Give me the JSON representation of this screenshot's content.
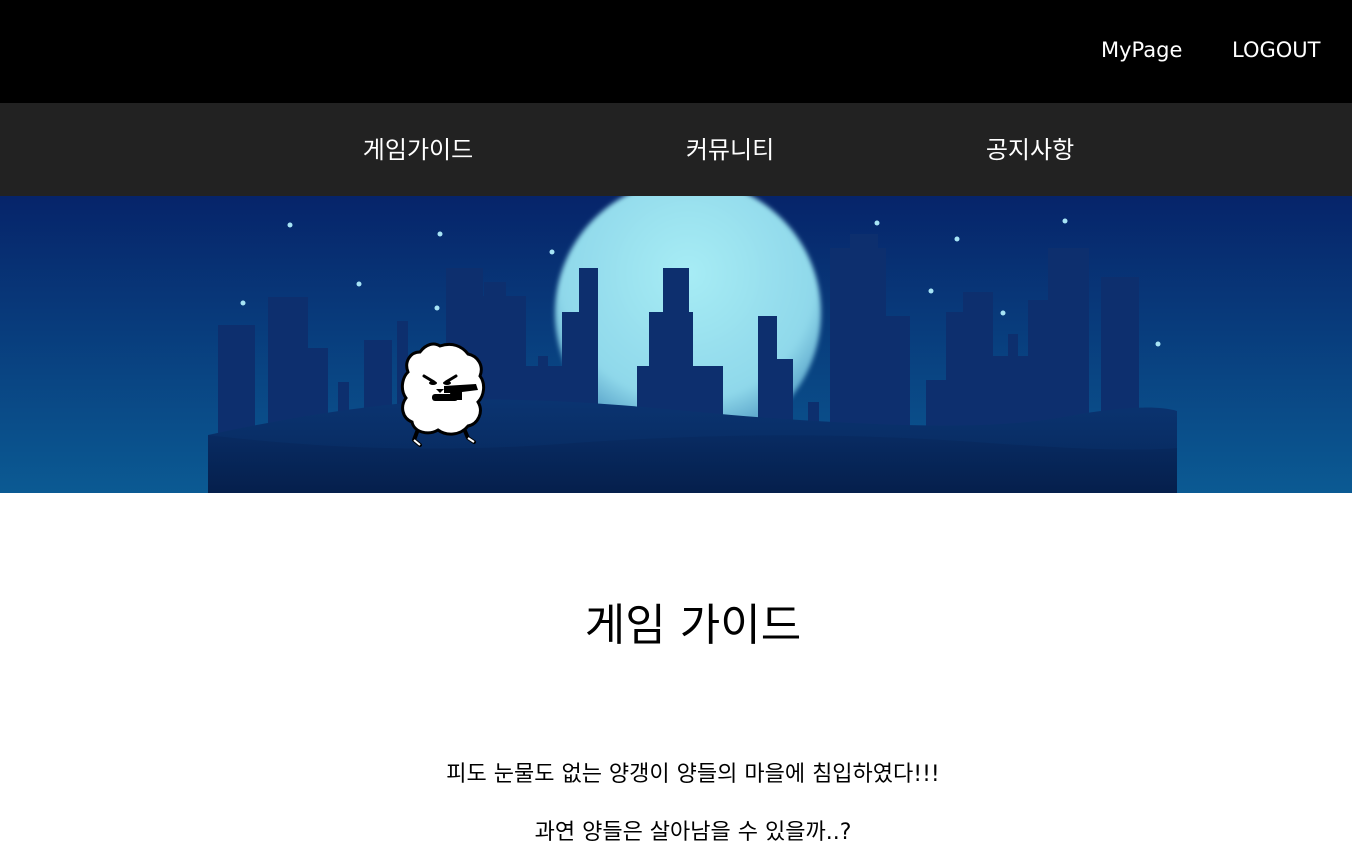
{
  "header": {
    "mypage_label": "MyPage",
    "logout_label": "LOGOUT"
  },
  "nav": {
    "items": [
      {
        "label": "게임가이드"
      },
      {
        "label": "커뮤니티"
      },
      {
        "label": "공지사항"
      }
    ]
  },
  "hero": {
    "colors": {
      "sky_top": "#06246a",
      "sky_bottom": "#0b5a93",
      "moon": "#9fe6f2",
      "buildings": "#0d2f6e",
      "hill": "#082a60"
    },
    "character_icon": "sheep-with-gun-icon"
  },
  "main": {
    "title": "게임 가이드",
    "description_lines": [
      "피도 눈물도 없는 양갱이 양들의 마을에 침입하였다!!!",
      "과연 양들은 살아남을 수 있을까..?"
    ]
  }
}
